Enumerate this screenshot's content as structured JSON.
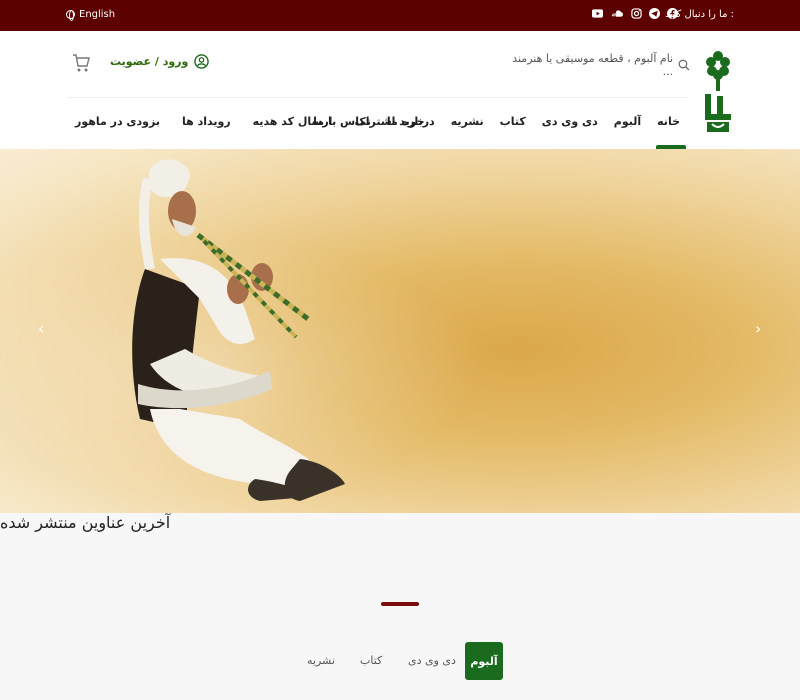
{
  "topbar": {
    "language": "English",
    "follow_label": "ما را دنبال کنید :",
    "socials": [
      "facebook-icon",
      "telegram-icon",
      "instagram-icon",
      "soundcloud-icon",
      "youtube-icon"
    ]
  },
  "header": {
    "search_placeholder": "نام آلبوم ، قطعه موسیقی یا هنرمند ...",
    "login_label": "ورود / عضویت"
  },
  "nav": {
    "items": [
      "خانه",
      "آلبوم",
      "دی وی دی",
      "کتاب",
      "نشریه",
      "درباره ما",
      "تماس با ما"
    ],
    "secondary": [
      "خرید اشتراک",
      "ارسال کد هدیه",
      "رویداد ها",
      "بزودی در ماهور"
    ]
  },
  "hero": {
    "left_arrow": "‹",
    "right_arrow": "›"
  },
  "latest": {
    "title": "آخرین عناوین منتشر شده",
    "tabs": [
      "آلبوم",
      "دی وی دی",
      "کتاب",
      "نشریه"
    ]
  },
  "colors": {
    "topbar": "#5c0000",
    "accent_green": "#1a6b1e",
    "accent_red": "#7a0c0c"
  }
}
